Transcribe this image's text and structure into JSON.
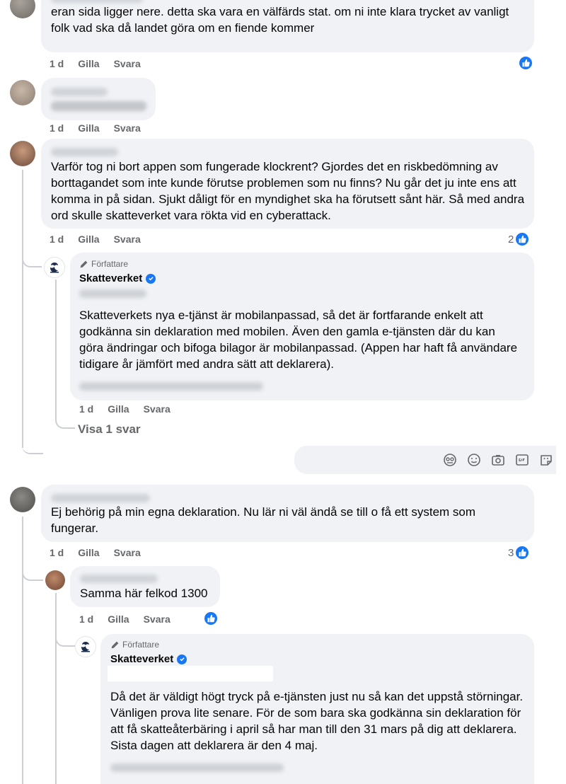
{
  "comments": [
    {
      "text": "eran sida ligger nere. detta ska vara en välfärds stat. om ni inte klara trycket av vanligt folk vad ska då landet göra om en fiende kommer",
      "time": "1 d",
      "like": "Gilla",
      "reply": "Svara",
      "reactions": ""
    },
    {
      "text": "",
      "time": "1 d",
      "like": "Gilla",
      "reply": "Svara"
    },
    {
      "text": "Varför tog ni bort appen som fungerade klockrent? Gjordes det en riskbedömning av borttagandet som inte kunde förutse problemen som nu finns? Nu går det ju inte ens att komma in på sidan. Sjukt dåligt för en myndighet ska ha förutsett sånt här. Så med andra ord skulle skatteverket vara rökta vid en cyberattack.",
      "time": "1 d",
      "like": "Gilla",
      "reply": "Svara",
      "reactions": "2"
    },
    {
      "text": "Ej behörig på min egna deklaration. Nu lär ni väl ändå se till o få ett system som fungerar.",
      "time": "1 d",
      "like": "Gilla",
      "reply": "Svara",
      "reactions": "3"
    }
  ],
  "replies": [
    {
      "author_tag": "Författare",
      "page_name": "Skatteverket",
      "text": "Skatteverkets nya e-tjänst är mobilanpassad, så det är fortfarande enkelt att godkänna sin deklaration med mobilen. Även den gamla e-tjänsten där du kan göra ändringar och bifoga bilagor är mobilanpassad. (Appen har haft få användare tidigare år jämfört med andra sätt att deklarera).",
      "time": "1 d",
      "like": "Gilla",
      "reply": "Svara"
    },
    {
      "text": "Samma här felkod 1300",
      "time": "1 d",
      "like": "Gilla",
      "reply": "Svara"
    },
    {
      "author_tag": "Författare",
      "page_name": "Skatteverket",
      "text": "Då det är väldigt högt tryck på e-tjänsten just nu så kan det uppstå störningar. Vänligen prova lite senare. För de som bara ska godkänna sin deklaration för att få skatteåterbäring i april så har man till den 31 mars på dig att deklarera. Sista dagen att deklarera är den 4 maj."
    }
  ],
  "view_replies": "Visa 1 svar",
  "icons": {
    "like": "thumbs-up-icon",
    "verified": "verified-badge-icon",
    "pen": "pen-icon",
    "composer": [
      "avatar-sticker-icon",
      "emoji-icon",
      "camera-icon",
      "gif-icon",
      "sticker-icon"
    ]
  },
  "colors": {
    "bubble": "#f0f2f5",
    "accent": "#1877f2",
    "meta": "#65676b"
  }
}
